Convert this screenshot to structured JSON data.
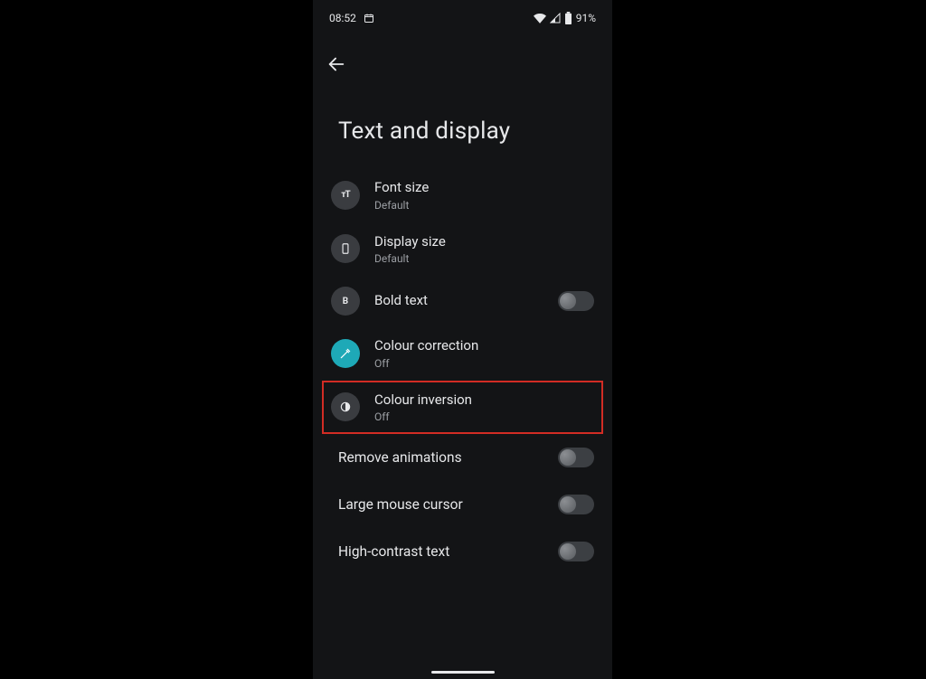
{
  "status": {
    "time": "08:52",
    "battery_pct": "91%"
  },
  "page": {
    "title": "Text and display"
  },
  "items": [
    {
      "label": "Font size",
      "sub": "Default",
      "icon": "text-size-icon",
      "icon_variant": "default",
      "has_sub": true,
      "has_toggle": false,
      "highlight": false
    },
    {
      "label": "Display size",
      "sub": "Default",
      "icon": "display-size-icon",
      "icon_variant": "default",
      "has_sub": true,
      "has_toggle": false,
      "highlight": false
    },
    {
      "label": "Bold text",
      "sub": "",
      "icon": "bold-icon",
      "icon_variant": "default",
      "has_sub": false,
      "has_toggle": true,
      "toggle_on": false,
      "highlight": false
    },
    {
      "label": "Colour correction",
      "sub": "Off",
      "icon": "eyedropper-icon",
      "icon_variant": "teal",
      "has_sub": true,
      "has_toggle": false,
      "highlight": false
    },
    {
      "label": "Colour inversion",
      "sub": "Off",
      "icon": "contrast-icon",
      "icon_variant": "default",
      "has_sub": true,
      "has_toggle": false,
      "highlight": true
    },
    {
      "label": "Remove animations",
      "sub": "",
      "icon": "",
      "icon_variant": "",
      "has_sub": false,
      "has_toggle": true,
      "toggle_on": false,
      "highlight": false
    },
    {
      "label": "Large mouse cursor",
      "sub": "",
      "icon": "",
      "icon_variant": "",
      "has_sub": false,
      "has_toggle": true,
      "toggle_on": false,
      "highlight": false
    },
    {
      "label": "High-contrast text",
      "sub": "",
      "icon": "",
      "icon_variant": "",
      "has_sub": false,
      "has_toggle": true,
      "toggle_on": false,
      "highlight": false
    }
  ]
}
